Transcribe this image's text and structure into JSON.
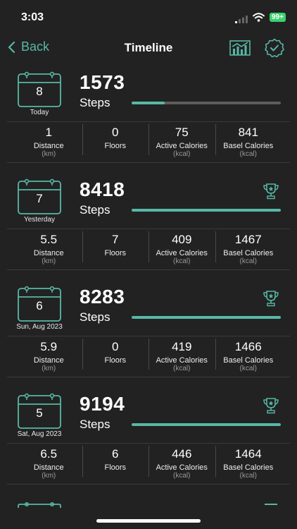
{
  "status": {
    "time": "3:03",
    "battery": "99+"
  },
  "nav": {
    "back_label": "Back",
    "title": "Timeline"
  },
  "colors": {
    "accent": "#57b8a5",
    "background": "#222222",
    "battery": "#3bd16f"
  },
  "days": [
    {
      "day_number": "8",
      "label": "Today",
      "steps": "1573",
      "steps_label": "Steps",
      "progress": 0.22,
      "trophy": false,
      "stats": [
        {
          "value": "1",
          "name": "Distance",
          "unit": "(km)"
        },
        {
          "value": "0",
          "name": "Floors",
          "unit": ""
        },
        {
          "value": "75",
          "name": "Active Calories",
          "unit": "(kcal)"
        },
        {
          "value": "841",
          "name": "Basel Calories",
          "unit": "(kcal)"
        }
      ]
    },
    {
      "day_number": "7",
      "label": "Yesterday",
      "steps": "8418",
      "steps_label": "Steps",
      "progress": 1.0,
      "trophy": true,
      "stats": [
        {
          "value": "5.5",
          "name": "Distance",
          "unit": "(km)"
        },
        {
          "value": "7",
          "name": "Floors",
          "unit": ""
        },
        {
          "value": "409",
          "name": "Active Calories",
          "unit": "(kcal)"
        },
        {
          "value": "1467",
          "name": "Basel Calories",
          "unit": "(kcal)"
        }
      ]
    },
    {
      "day_number": "6",
      "label": "Sun, Aug 2023",
      "steps": "8283",
      "steps_label": "Steps",
      "progress": 1.0,
      "trophy": true,
      "stats": [
        {
          "value": "5.9",
          "name": "Distance",
          "unit": "(km)"
        },
        {
          "value": "0",
          "name": "Floors",
          "unit": ""
        },
        {
          "value": "419",
          "name": "Active Calories",
          "unit": "(kcal)"
        },
        {
          "value": "1466",
          "name": "Basel Calories",
          "unit": "(kcal)"
        }
      ]
    },
    {
      "day_number": "5",
      "label": "Sat, Aug 2023",
      "steps": "9194",
      "steps_label": "Steps",
      "progress": 1.0,
      "trophy": true,
      "stats": [
        {
          "value": "6.5",
          "name": "Distance",
          "unit": "(km)"
        },
        {
          "value": "6",
          "name": "Floors",
          "unit": ""
        },
        {
          "value": "446",
          "name": "Active Calories",
          "unit": "(kcal)"
        },
        {
          "value": "1464",
          "name": "Basel Calories",
          "unit": "(kcal)"
        }
      ]
    }
  ]
}
